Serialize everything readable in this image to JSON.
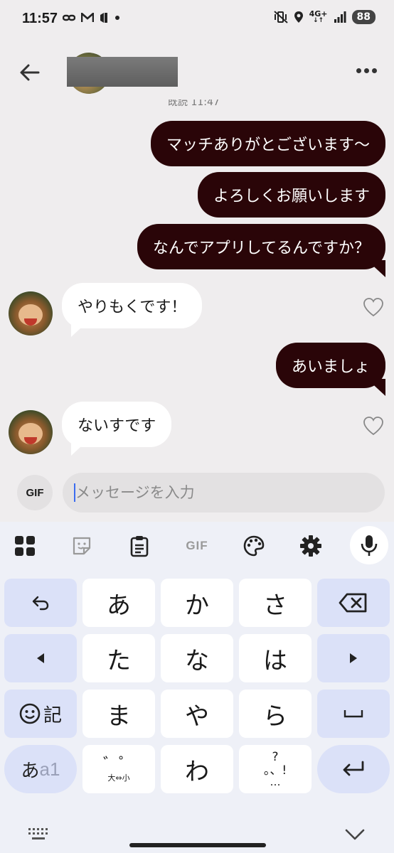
{
  "status_bar": {
    "time": "11:57",
    "left_icons": [
      "link-icon",
      "gmail-icon",
      "app-icon",
      "dot-icon"
    ],
    "network": "4G+",
    "battery": "88"
  },
  "header": {
    "clipped_timestamp": "既読 11:47"
  },
  "messages": [
    {
      "direction": "out",
      "text": "マッチありがとございます〜"
    },
    {
      "direction": "out",
      "text": "よろしくお願いします"
    },
    {
      "direction": "out",
      "text": "なんでアプリしてるんですか？"
    },
    {
      "direction": "in",
      "text": "やりもくです！"
    },
    {
      "direction": "out",
      "text": "あいましょ"
    },
    {
      "direction": "in",
      "text": "ないすです"
    }
  ],
  "composer": {
    "gif_label": "GIF",
    "placeholder": "メッセージを入力"
  },
  "keyboard": {
    "toolbar_gif_label": "GIF",
    "rows": [
      [
        "undo",
        "あ",
        "か",
        "さ",
        "backspace"
      ],
      [
        "left",
        "た",
        "な",
        "は",
        "right"
      ],
      [
        "emoji-kigou",
        "ま",
        "や",
        "ら",
        "space"
      ],
      [
        "kana-alpha",
        "dakuten",
        "わ",
        "punct",
        "enter"
      ]
    ],
    "keys": {
      "a": "あ",
      "ka": "か",
      "sa": "さ",
      "ta": "た",
      "na": "な",
      "ha": "は",
      "ma": "ま",
      "ya": "や",
      "ra": "ら",
      "wa": "わ",
      "kigou": "記",
      "mode_kana": "あ",
      "mode_alpha": "a1",
      "dakuten_top": "゛゜",
      "dakuten_bottom": "大⇔小",
      "punct_top": "?",
      "punct_mid": "。、!",
      "punct_bottom": "…"
    }
  }
}
